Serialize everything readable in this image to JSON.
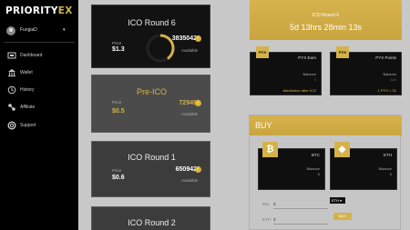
{
  "brand": {
    "logo_main": "PRIORITY",
    "logo_accent": "EX"
  },
  "user": {
    "name": "FungiaD",
    "caret": "▾"
  },
  "nav": [
    {
      "label": "Dashboard",
      "icon": "dashboard-icon"
    },
    {
      "label": "Wallet",
      "icon": "bank-icon"
    },
    {
      "label": "History",
      "icon": "history-icon"
    },
    {
      "label": "Affiliate",
      "icon": "affiliate-icon"
    },
    {
      "label": "Support",
      "icon": "support-icon"
    }
  ],
  "rounds": [
    {
      "title": "ICO Round 6",
      "price_label": "Price",
      "price": "$1.3",
      "available": "3835042",
      "available_label": "Available",
      "progress": 0.42
    },
    {
      "title": "Pre-ICO",
      "price_label": "Price",
      "price": "$0.5",
      "available": "72949",
      "available_label": "Available"
    },
    {
      "title": "ICO Round 1",
      "price_label": "Price",
      "price": "$0.6",
      "available": "650942",
      "available_label": "Available"
    },
    {
      "title": "ICO Round 2"
    }
  ],
  "timer": {
    "label": "ICO Round 6",
    "countdown": "5d 13hrs 28min 13s"
  },
  "token_cards": [
    {
      "tag": "PYX",
      "name": "PYX Earn",
      "balance_label": "Balance",
      "balance": "0",
      "note": "distribution after ICO"
    },
    {
      "tag": "PYX",
      "name": "PYX Points",
      "balance_label": "Balance",
      "balance": "100",
      "note": "1 PYX = 31"
    }
  ],
  "buy": {
    "title": "BUY",
    "coins": [
      {
        "name": "BTC",
        "symbol": "₿",
        "balance_label": "Balance",
        "balance": "0"
      },
      {
        "name": "ETH",
        "symbol": "◆",
        "balance_label": "Balance",
        "balance": "0"
      }
    ],
    "pyx_label": "Pyx",
    "pyx_value": "$",
    "eth_label": "ETH",
    "eth_value": "$",
    "currency": "ETH ▾",
    "button": "BUY"
  },
  "colors": {
    "gold": "#d4b24a",
    "sidebar": "#000000",
    "card": "#121212"
  }
}
